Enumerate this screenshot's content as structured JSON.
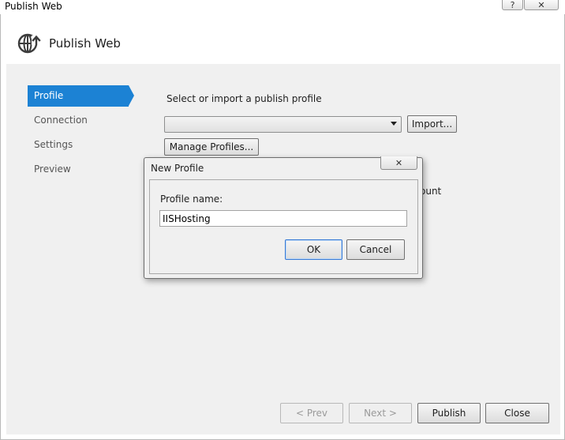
{
  "window": {
    "title": "Publish Web",
    "help_glyph": "?",
    "close_glyph": "✕"
  },
  "header": {
    "title": "Publish Web",
    "icon": "globe-publish-icon"
  },
  "nav": {
    "items": [
      {
        "label": "Profile",
        "selected": true
      },
      {
        "label": "Connection",
        "selected": false
      },
      {
        "label": "Settings",
        "selected": false
      },
      {
        "label": "Preview",
        "selected": false
      }
    ]
  },
  "profile_page": {
    "select_label": "Select or import a publish profile",
    "combo_value": "",
    "import_label": "Import...",
    "manage_label": "Manage Profiles...",
    "obscured_fragment": "ount"
  },
  "footer": {
    "prev_label": "< Prev",
    "next_label": "Next >",
    "publish_label": "Publish",
    "close_label": "Close"
  },
  "modal": {
    "title": "New Profile",
    "close_glyph": "✕",
    "name_label": "Profile name:",
    "name_value": "IISHosting",
    "ok_label": "OK",
    "cancel_label": "Cancel"
  },
  "colors": {
    "accent": "#1c82d4",
    "body_bg": "#f0f0f0"
  }
}
